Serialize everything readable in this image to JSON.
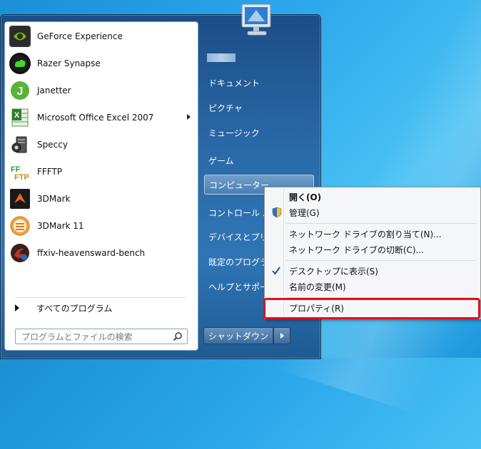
{
  "programs": [
    {
      "label": "GeForce Experience",
      "icon": "geforce-icon"
    },
    {
      "label": "Razer Synapse",
      "icon": "razer-icon"
    },
    {
      "label": "Janetter",
      "icon": "janetter-icon"
    },
    {
      "label": "Microsoft Office Excel 2007",
      "icon": "excel-icon",
      "submenu": true
    },
    {
      "label": "Speccy",
      "icon": "speccy-icon"
    },
    {
      "label": "FFFTP",
      "icon": "ffftp-icon"
    },
    {
      "label": "3DMark",
      "icon": "3dmark-icon"
    },
    {
      "label": "3DMark 11",
      "icon": "3dmark11-icon"
    },
    {
      "label": "ffxiv-heavensward-bench",
      "icon": "ffxiv-icon"
    }
  ],
  "all_programs": "すべてのプログラム",
  "search": {
    "placeholder": "プログラムとファイルの検索"
  },
  "right_pane": {
    "documents": "ドキュメント",
    "pictures": "ピクチャ",
    "music": "ミュージック",
    "games": "ゲーム",
    "computer": "コンピューター",
    "control_panel": "コントロール パネル",
    "devices": "デバイスとプリンター",
    "default_programs": "既定のプログラム",
    "help": "ヘルプとサポート"
  },
  "shutdown": {
    "label": "シャットダウン"
  },
  "context_menu": {
    "open": "開く(O)",
    "manage": "管理(G)",
    "map_drive": "ネットワーク ドライブの割り当て(N)...",
    "disconnect_drive": "ネットワーク ドライブの切断(C)...",
    "show_on_desktop": "デスクトップに表示(S)",
    "rename": "名前の変更(M)",
    "properties": "プロパティ(R)"
  },
  "colors": {
    "highlight": "#e0101e",
    "menu_blue": "#2a6aa8"
  }
}
